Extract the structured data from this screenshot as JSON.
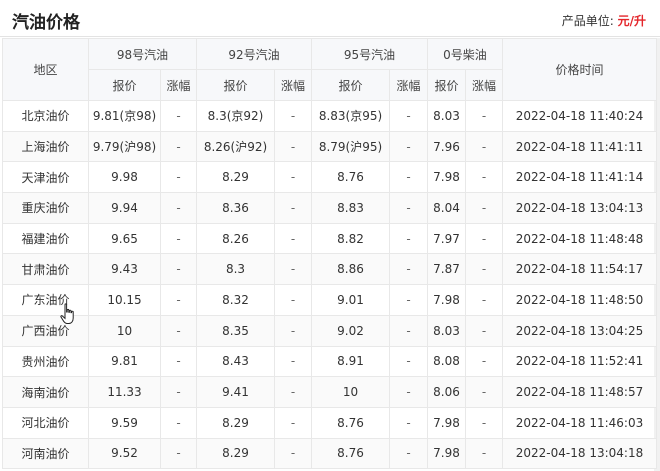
{
  "header": {
    "title": "汽油价格",
    "unit_label": "产品单位:",
    "unit_value": "元/升"
  },
  "table": {
    "region_header": "地区",
    "time_header": "价格时间",
    "groups": [
      "98号汽油",
      "92号汽油",
      "95号汽油",
      "0号柴油"
    ],
    "sub_headers": [
      "报价",
      "涨幅"
    ],
    "rows": [
      {
        "region": "北京油价",
        "p98": "9.81(京98)",
        "c98": "-",
        "p92": "8.3(京92)",
        "c92": "-",
        "p95": "8.83(京95)",
        "c95": "-",
        "p0": "8.03",
        "c0": "-",
        "time": "2022-04-18 11:40:24"
      },
      {
        "region": "上海油价",
        "p98": "9.79(沪98)",
        "c98": "-",
        "p92": "8.26(沪92)",
        "c92": "-",
        "p95": "8.79(沪95)",
        "c95": "-",
        "p0": "7.96",
        "c0": "-",
        "time": "2022-04-18 11:41:11"
      },
      {
        "region": "天津油价",
        "p98": "9.98",
        "c98": "-",
        "p92": "8.29",
        "c92": "-",
        "p95": "8.76",
        "c95": "-",
        "p0": "7.98",
        "c0": "-",
        "time": "2022-04-18 11:41:14"
      },
      {
        "region": "重庆油价",
        "p98": "9.94",
        "c98": "-",
        "p92": "8.36",
        "c92": "-",
        "p95": "8.83",
        "c95": "-",
        "p0": "8.04",
        "c0": "-",
        "time": "2022-04-18 13:04:13"
      },
      {
        "region": "福建油价",
        "p98": "9.65",
        "c98": "-",
        "p92": "8.26",
        "c92": "-",
        "p95": "8.82",
        "c95": "-",
        "p0": "7.97",
        "c0": "-",
        "time": "2022-04-18 11:48:48"
      },
      {
        "region": "甘肃油价",
        "p98": "9.43",
        "c98": "-",
        "p92": "8.3",
        "c92": "-",
        "p95": "8.86",
        "c95": "-",
        "p0": "7.87",
        "c0": "-",
        "time": "2022-04-18 11:54:17"
      },
      {
        "region": "广东油价",
        "p98": "10.15",
        "c98": "-",
        "p92": "8.32",
        "c92": "-",
        "p95": "9.01",
        "c95": "-",
        "p0": "7.98",
        "c0": "-",
        "time": "2022-04-18 11:48:50"
      },
      {
        "region": "广西油价",
        "p98": "10",
        "c98": "-",
        "p92": "8.35",
        "c92": "-",
        "p95": "9.02",
        "c95": "-",
        "p0": "8.03",
        "c0": "-",
        "time": "2022-04-18 13:04:25"
      },
      {
        "region": "贵州油价",
        "p98": "9.81",
        "c98": "-",
        "p92": "8.43",
        "c92": "-",
        "p95": "8.91",
        "c95": "-",
        "p0": "8.08",
        "c0": "-",
        "time": "2022-04-18 11:52:41"
      },
      {
        "region": "海南油价",
        "p98": "11.33",
        "c98": "-",
        "p92": "9.41",
        "c92": "-",
        "p95": "10",
        "c95": "-",
        "p0": "8.06",
        "c0": "-",
        "time": "2022-04-18 11:48:57"
      },
      {
        "region": "河北油价",
        "p98": "9.59",
        "c98": "-",
        "p92": "8.29",
        "c92": "-",
        "p95": "8.76",
        "c95": "-",
        "p0": "7.98",
        "c0": "-",
        "time": "2022-04-18 11:46:03"
      },
      {
        "region": "河南油价",
        "p98": "9.52",
        "c98": "-",
        "p92": "8.29",
        "c92": "-",
        "p95": "8.76",
        "c95": "-",
        "p0": "7.98",
        "c0": "-",
        "time": "2022-04-18 13:04:18"
      }
    ]
  },
  "cursor_icon": "hand-pointer-icon"
}
